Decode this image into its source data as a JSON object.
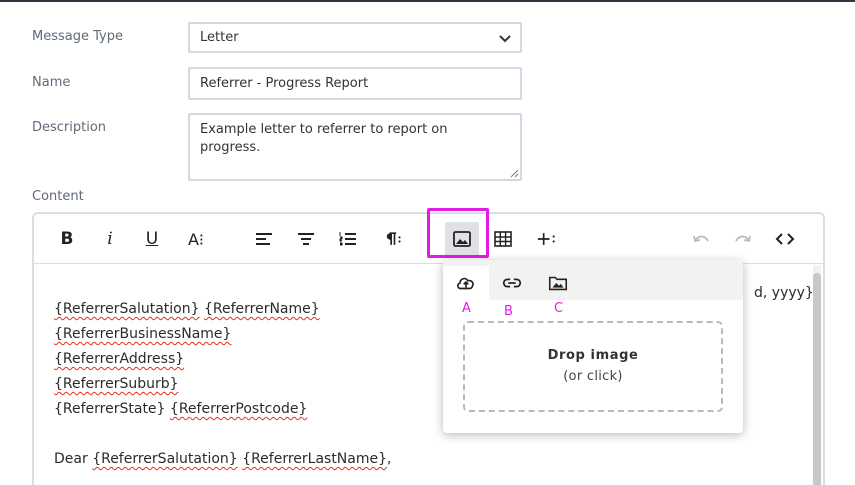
{
  "form": {
    "message_type_label": "Message Type",
    "message_type_value": "Letter",
    "name_label": "Name",
    "name_value": "Referrer - Progress Report",
    "description_label": "Description",
    "description_value": "Example letter to referrer to report on progress.",
    "content_label": "Content"
  },
  "toolbar": {
    "bold": "B",
    "italic": "i",
    "underline": "U",
    "font_size": "A⁝"
  },
  "editor": {
    "date_tail": "d, yyyy}",
    "lines": [
      [
        {
          "t": "{ReferrerSalutation}",
          "sq": true
        },
        {
          "t": " ",
          "sq": false
        },
        {
          "t": "{ReferrerName}",
          "sq": true
        }
      ],
      [
        {
          "t": "{ReferrerBusinessName}",
          "sq": true
        }
      ],
      [
        {
          "t": "{ReferrerAddress}",
          "sq": true
        }
      ],
      [
        {
          "t": "{ReferrerSuburb}",
          "sq": true
        }
      ],
      [
        {
          "t": "{ReferrerState}",
          "sq": false
        },
        {
          "t": " ",
          "sq": false
        },
        {
          "t": "{ReferrerPostcode}",
          "sq": true
        }
      ],
      [],
      [
        {
          "t": "Dear ",
          "sq": false
        },
        {
          "t": "{ReferrerSalutation}",
          "sq": true
        },
        {
          "t": " ",
          "sq": false
        },
        {
          "t": "{ReferrerLastName}",
          "sq": true
        },
        {
          "t": ",",
          "sq": false
        }
      ]
    ]
  },
  "image_popup": {
    "tabs": [
      {
        "icon": "upload-cloud-icon",
        "annotation": "A"
      },
      {
        "icon": "link-icon",
        "annotation": "B"
      },
      {
        "icon": "image-gallery-icon",
        "annotation": "C"
      }
    ],
    "drop_title": "Drop image",
    "drop_subtitle": "(or click)"
  },
  "colors": {
    "highlight": "#e21ce2",
    "border": "#cfd9e3",
    "label": "#5f6b7a"
  }
}
